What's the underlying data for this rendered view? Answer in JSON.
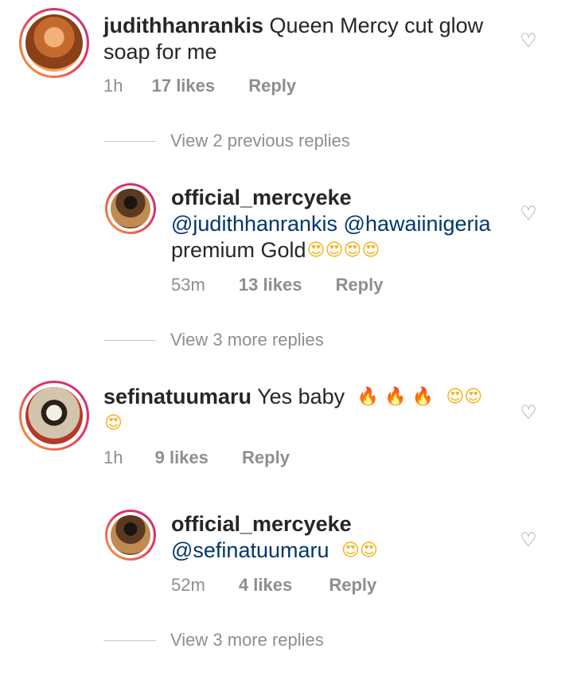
{
  "comments": [
    {
      "username": "judithhanrankis",
      "text_line1": "Queen Mercy cut glow",
      "text_line2": "soap for me",
      "time": "1h",
      "likes": "17 likes",
      "reply": "Reply"
    },
    {
      "username": "official_mercyeke",
      "mention1": "@judithhanrankis",
      "mention2": "@hawaiinigeria",
      "text": "premium Gold",
      "emoji": "😍😍😍😍",
      "time": "53m",
      "likes": "13 likes",
      "reply": "Reply"
    },
    {
      "username": "sefinatuumaru",
      "text": "Yes baby",
      "emoji_fire": "🔥 🔥 🔥",
      "emoji_love": "😍😍",
      "emoji_line2": "😍",
      "time": "1h",
      "likes": "9 likes",
      "reply": "Reply"
    },
    {
      "username": "official_mercyeke",
      "mention": "@sefinatuumaru",
      "emoji": "😍😍",
      "time": "52m",
      "likes": "4 likes",
      "reply": "Reply"
    }
  ],
  "view_replies": [
    "View 2 previous replies",
    "View 3 more replies",
    "View 3 more replies"
  ],
  "icons": {
    "heart": "heart-outline-icon"
  },
  "colors": {
    "username": "#262626",
    "mention": "#00376b",
    "meta": "#8e8e8e",
    "story_ring_start": "#f9a23a",
    "story_ring_end": "#c2307f"
  }
}
